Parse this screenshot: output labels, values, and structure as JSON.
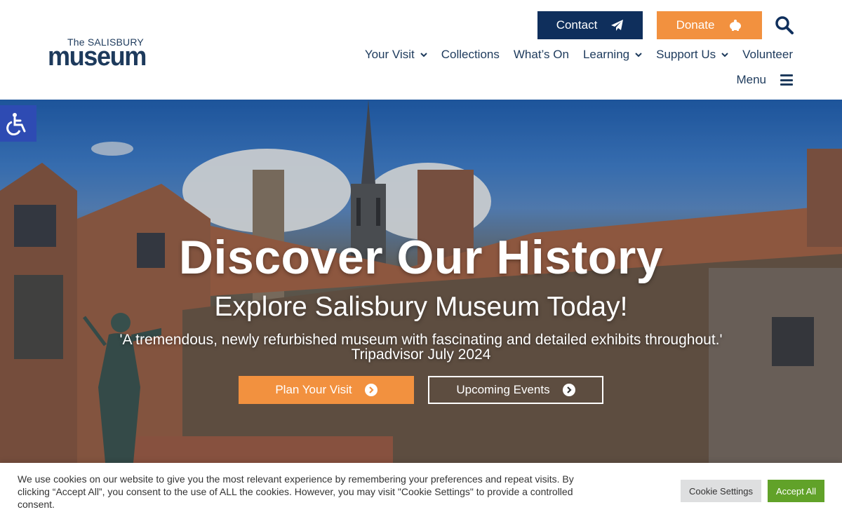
{
  "logo": {
    "small": "The SALISBURY",
    "big": "museum"
  },
  "header": {
    "contact_label": "Contact",
    "donate_label": "Donate",
    "menu_label": "Menu"
  },
  "nav": {
    "items": [
      {
        "label": "Your Visit",
        "has_dropdown": true
      },
      {
        "label": "Collections",
        "has_dropdown": false
      },
      {
        "label": "What’s On",
        "has_dropdown": false
      },
      {
        "label": "Learning",
        "has_dropdown": true
      },
      {
        "label": "Support Us",
        "has_dropdown": true
      },
      {
        "label": "Volunteer",
        "has_dropdown": false
      }
    ]
  },
  "hero": {
    "title": "Discover Our History",
    "subtitle": "Explore Salisbury Museum Today!",
    "quote": "'A tremendous, newly refurbished museum with fascinating and detailed exhibits throughout.'",
    "quote_source": "Tripadvisor July 2024",
    "plan_label": "Plan Your Visit",
    "events_label": "Upcoming Events"
  },
  "cookie": {
    "text": "We use cookies on our website to give you the most relevant experience by remembering your preferences and repeat visits. By clicking “Accept All”, you consent to the use of ALL the cookies. However, you may visit \"Cookie Settings\" to provide a controlled consent.",
    "settings_label": "Cookie Settings",
    "accept_label": "Accept All"
  },
  "colors": {
    "navy": "#0f2f5c",
    "orange": "#f2913f",
    "text_blue": "#1d3a5c",
    "accessibility_blue": "#2e4bb3",
    "accept_green": "#61a229"
  }
}
